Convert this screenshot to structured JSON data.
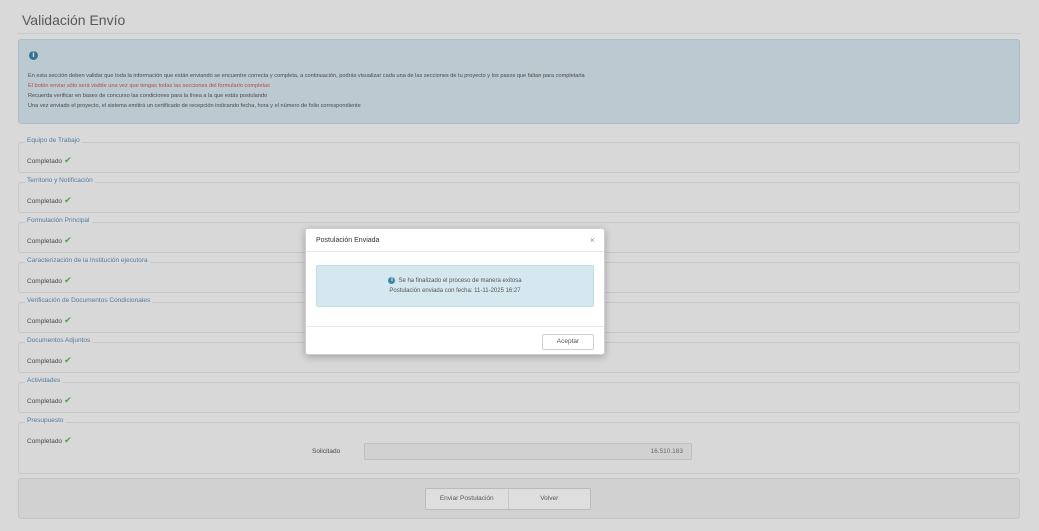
{
  "page": {
    "title": "Validación Envío"
  },
  "info": {
    "lines": [
      "En esta sección deben validar que toda la información que están enviando se encuentre correcta y completa, a continuación, podrás visualizar cada una de las secciones de tu proyecto y los pasos que faltan para completarla",
      "El botón enviar sólo será visible una vez que tengas todas las secciones del formulario completas",
      "Recuerda verificar en bases de concurso las condiciones para la línea a la que estás postulando",
      "Una vez enviado el proyecto, el sistema emitirá un certificado de recepción indicando fecha, hora y el número de folio correspondiente"
    ]
  },
  "sections": [
    {
      "title": "Equipo de Trabajo",
      "status": "Completado"
    },
    {
      "title": "Territorio y Notificación",
      "status": "Completado"
    },
    {
      "title": "Formulación Principal",
      "status": "Completado"
    },
    {
      "title": "Caracterización de la Institución ejecutora",
      "status": "Completado"
    },
    {
      "title": "Verificación de Documentos Condicionales",
      "status": "Completado"
    },
    {
      "title": "Documentos Adjuntos",
      "status": "Completado"
    },
    {
      "title": "Actividades",
      "status": "Completado"
    },
    {
      "title": "Presupuesto",
      "status": "Completado"
    }
  ],
  "budget": {
    "solicitado_label": "Solicitado",
    "solicitado_value": "16.510.183"
  },
  "actions": {
    "enviar": "Enviar Postulación",
    "volver": "Volver"
  },
  "modal": {
    "title": "Postulación Enviada",
    "close": "×",
    "message_line1": "Se ha finalizado el proceso de manera exitosa",
    "message_line2": "Postulación enviada con fecha: 11-11-2025 16:27",
    "ok_label": "Aceptar"
  },
  "icons": {
    "check": "✔",
    "info": "i"
  },
  "colors": {
    "info_bg": "#d6e8ef",
    "section_title": "#5d8fb8",
    "check": "#5cb85c",
    "warning_text": "#d9534f"
  }
}
